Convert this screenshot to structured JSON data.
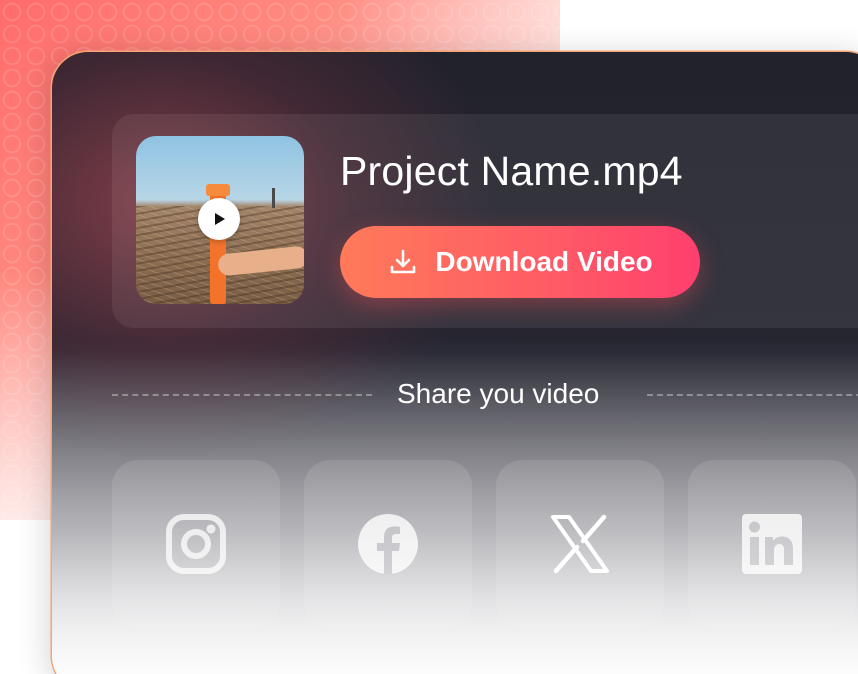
{
  "file": {
    "name": "Project Name.mp4"
  },
  "actions": {
    "download_label": "Download Video"
  },
  "share": {
    "label": "Share you video",
    "networks": [
      {
        "name": "instagram",
        "icon": "instagram-icon"
      },
      {
        "name": "facebook",
        "icon": "facebook-icon"
      },
      {
        "name": "x",
        "icon": "x-icon"
      },
      {
        "name": "linkedin",
        "icon": "linkedin-icon"
      }
    ]
  },
  "colors": {
    "accent_start": "#ff7a59",
    "accent_end": "#ff3f6e",
    "panel_bg": "#22222c",
    "panel_border": "#f4a574"
  }
}
